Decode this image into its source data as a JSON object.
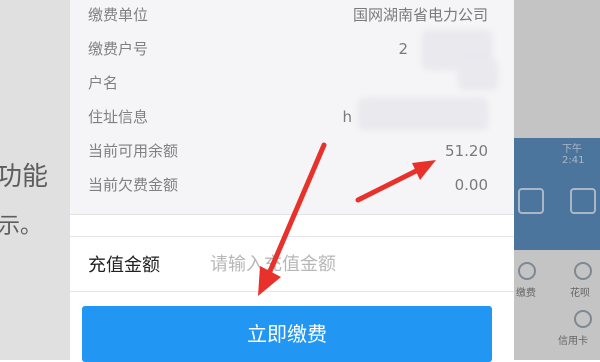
{
  "background_page": {
    "left_line1": "功能",
    "left_line2": "示。",
    "right_time": "下午2:41",
    "right_labels": [
      "缴费",
      "花呗",
      "信用卡"
    ]
  },
  "account_info": {
    "rows": [
      {
        "label": "缴费单位",
        "value": "国网湖南省电力公司"
      },
      {
        "label": "缴费户号",
        "value": "2"
      },
      {
        "label": "户名",
        "value": ""
      },
      {
        "label": "住址信息",
        "value": "h"
      },
      {
        "label": "当前可用余额",
        "value": "51.20"
      },
      {
        "label": "当前欠费金额",
        "value": "0.00"
      }
    ]
  },
  "recharge": {
    "label": "充值金额",
    "placeholder": "请输入充值金额"
  },
  "pay_button": {
    "label": "立即缴费"
  },
  "colors": {
    "accent": "#2196f3",
    "annotation_arrow": "#e8312b"
  }
}
